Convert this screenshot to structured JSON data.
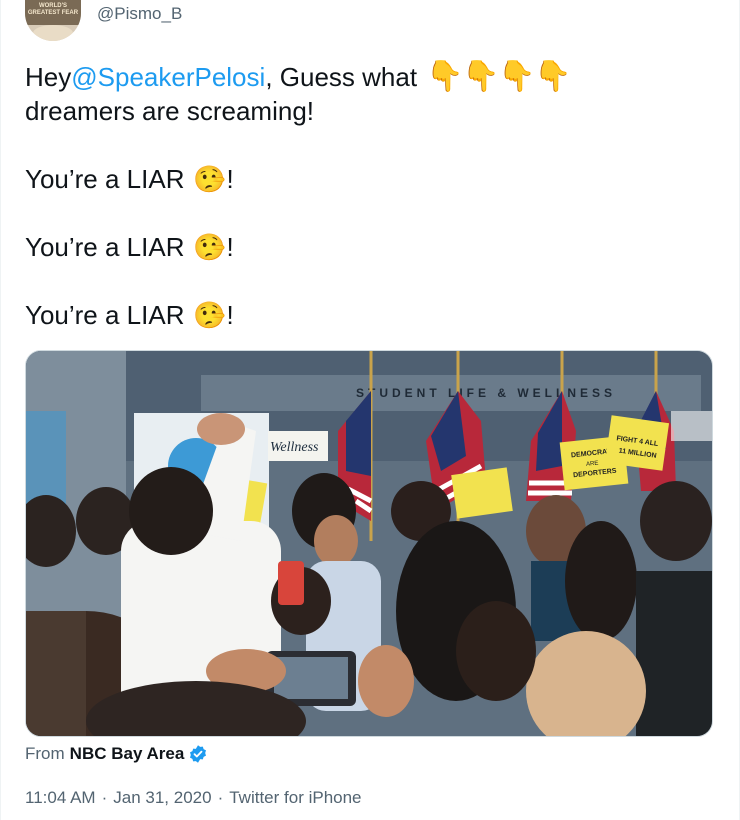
{
  "tweet": {
    "handle": "@Pismo_B",
    "avatar_caption": "WORLD'S GREATEST FEAR",
    "text": {
      "hey": "Hey ",
      "mention": "@SpeakerPelosi",
      "after_mention": ", Guess what",
      "line2": "dreamers are screaming!",
      "liar_lines": [
        "You’re a LIAR",
        "You’re a LIAR",
        "You’re a LIAR"
      ],
      "exclamation": "!"
    },
    "emojis": {
      "pointing_down": "👇",
      "lying_face": "🤥"
    },
    "media": {
      "signs": [
        "Wellness",
        "DEMOCRATS ARE DEPORTERS",
        "FIGHT 4 ALL 11 MILLION"
      ]
    },
    "source": {
      "prefix": "From",
      "org": "NBC Bay Area"
    },
    "meta": {
      "time": "11:04 AM",
      "separator": "·",
      "date": "Jan 31, 2020",
      "client": "Twitter for iPhone"
    },
    "colors": {
      "link": "#1d9bf0",
      "text": "#0f1419",
      "secondary": "#536471",
      "verified": "#1d9bf0"
    }
  }
}
